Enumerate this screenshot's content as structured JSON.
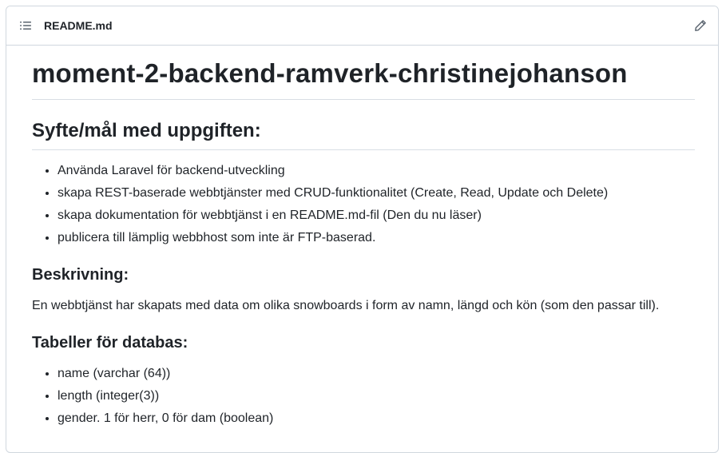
{
  "header": {
    "file_name": "README.md",
    "toc_icon": "list-unordered-icon",
    "edit_icon": "pencil-icon"
  },
  "content": {
    "title": "moment-2-backend-ramverk-christinejohanson",
    "purpose_heading": "Syfte/mål med uppgiften:",
    "purpose_items": [
      "Använda Laravel för backend-utveckling",
      "skapa REST-baserade webbtjänster med CRUD-funktionalitet (Create, Read, Update och Delete)",
      "skapa dokumentation för webbtjänst i en README.md-fil (Den du nu läser)",
      "publicera till lämplig webbhost som inte är FTP-baserad."
    ],
    "description_heading": "Beskrivning:",
    "description_text": "En webbtjänst har skapats med data om olika snowboards i form av namn, längd och kön (som den passar till).",
    "tables_heading": "Tabeller för databas:",
    "table_items": [
      "name (varchar (64))",
      "length (integer(3))",
      "gender. 1 för herr, 0 för dam (boolean)"
    ]
  }
}
